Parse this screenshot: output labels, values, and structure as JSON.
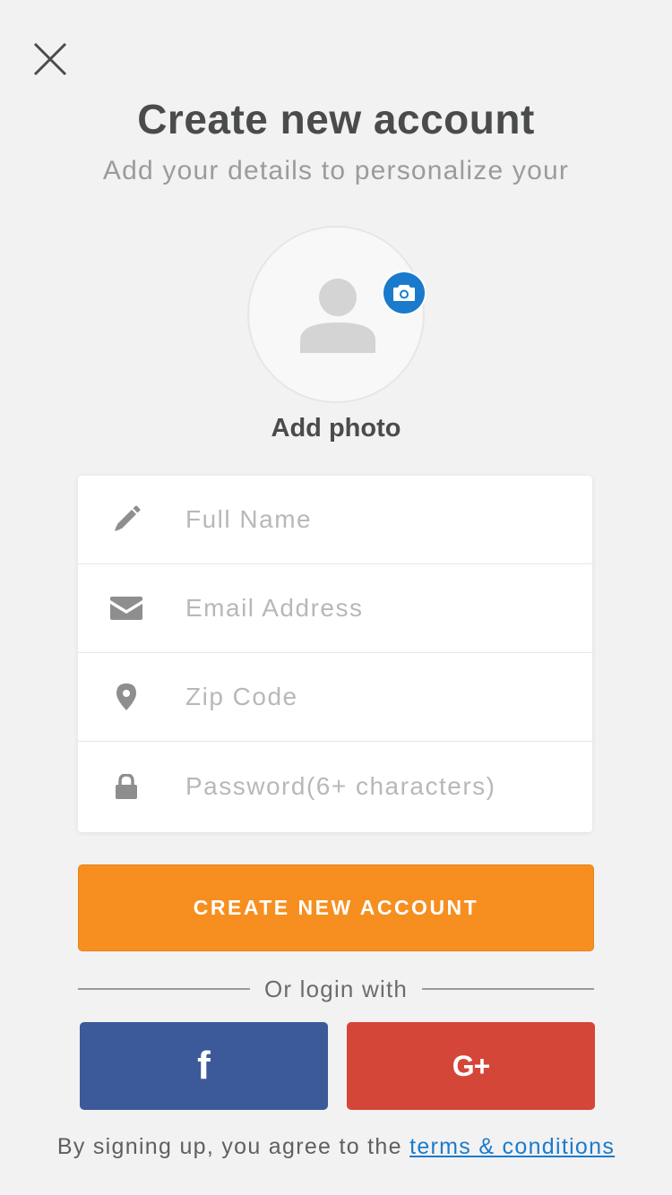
{
  "header": {
    "title": "Create new account",
    "subtitle": "Add your details to personalize your"
  },
  "icons": {
    "close": "close-icon",
    "avatar": "person-icon",
    "camera": "camera-icon",
    "name": "pencil-icon",
    "email": "envelope-icon",
    "zip": "map-pin-icon",
    "password": "lock-icon",
    "facebook": "facebook-icon",
    "google": "google-plus-icon"
  },
  "photo": {
    "label": "Add photo"
  },
  "form": {
    "full_name": {
      "placeholder": "Full Name",
      "value": ""
    },
    "email": {
      "placeholder": "Email Address",
      "value": ""
    },
    "zip": {
      "placeholder": "Zip Code",
      "value": ""
    },
    "password": {
      "placeholder": "Password(6+ characters)",
      "value": ""
    }
  },
  "actions": {
    "create_label": "CREATE NEW ACCOUNT",
    "divider_label": "Or login with",
    "facebook_label": "f",
    "google_label": "G+"
  },
  "footer": {
    "prefix": "By signing up, you agree to the ",
    "link": "terms & conditions"
  },
  "colors": {
    "background": "#f2f2f2",
    "accent_orange": "#f68f1f",
    "facebook_blue": "#3c5a99",
    "google_red": "#d44638",
    "link_blue": "#1a7bcc",
    "title_text": "#4a4c4b",
    "icon_gray": "#8e8e8e"
  }
}
